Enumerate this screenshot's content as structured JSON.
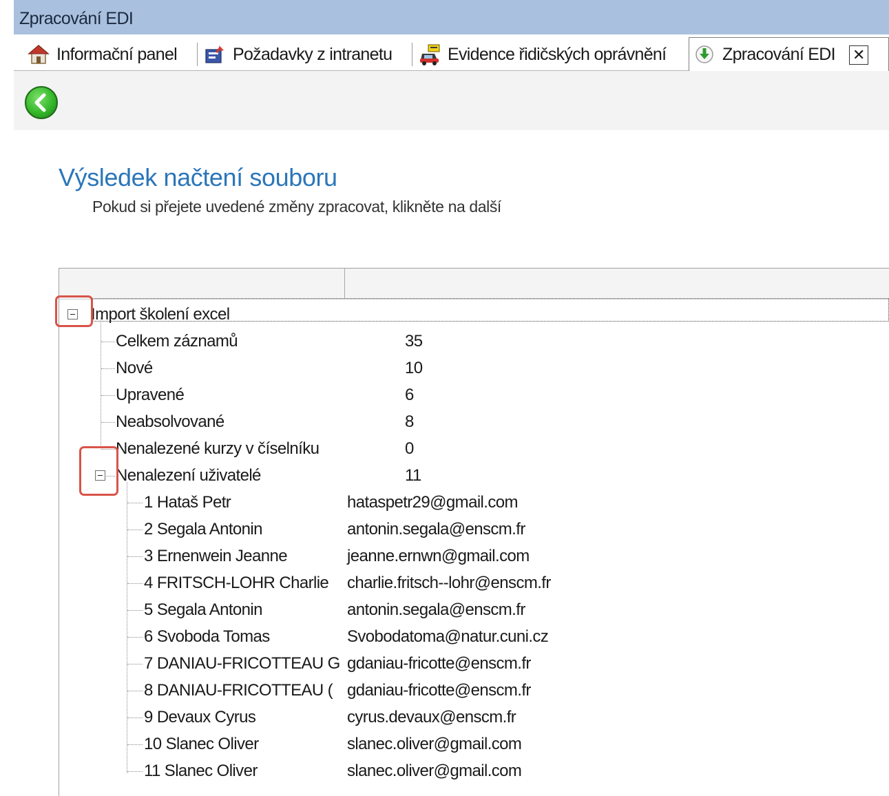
{
  "window": {
    "title": "Zpracování EDI"
  },
  "tabs": [
    {
      "label": "Informační panel",
      "icon": "house-icon",
      "active": false
    },
    {
      "label": "Požadavky z intranetu",
      "icon": "request-icon",
      "active": false
    },
    {
      "label": "Evidence řidičských oprávnění",
      "icon": "car-icon",
      "active": false
    },
    {
      "label": "Zpracování EDI",
      "icon": "download-icon",
      "active": true,
      "close": "✕"
    }
  ],
  "toolbar": {
    "back_icon": "back-arrow-icon"
  },
  "page": {
    "title": "Výsledek načtení souboru",
    "subtitle": "Pokud si přejete uvedené změny zpracovat, klikněte na další"
  },
  "tree": {
    "root": {
      "label": "Import školení excel",
      "expanded": true
    },
    "summary": [
      {
        "label": "Celkem záznamů",
        "value": "35"
      },
      {
        "label": "Nové",
        "value": "10"
      },
      {
        "label": "Upravené",
        "value": "6"
      },
      {
        "label": "Neabsolvované",
        "value": "8"
      },
      {
        "label": "Nenalezené kurzy v číselníku",
        "value": "0"
      }
    ],
    "users_group": {
      "label": "Nenalezení uživatelé",
      "value": "11",
      "expanded": true
    },
    "users": [
      {
        "label": "1 Hataš Petr",
        "value": "hataspetr29@gmail.com"
      },
      {
        "label": "2 Segala Antonin",
        "value": "antonin.segala@enscm.fr"
      },
      {
        "label": "3 Ernenwein Jeanne",
        "value": "jeanne.ernwn@gmail.com"
      },
      {
        "label": "4 FRITSCH-LOHR Charlie",
        "value": "charlie.fritsch--lohr@enscm.fr"
      },
      {
        "label": "5 Segala Antonin",
        "value": "antonin.segala@enscm.fr"
      },
      {
        "label": "6 Svoboda Tomas",
        "value": "Svobodatoma@natur.cuni.cz"
      },
      {
        "label": "7 DANIAU-FRICOTTEAU G",
        "value": "gdaniau-fricotte@enscm.fr"
      },
      {
        "label": "8 DANIAU-FRICOTTEAU (",
        "value": "gdaniau-fricotte@enscm.fr"
      },
      {
        "label": "9 Devaux Cyrus",
        "value": "cyrus.devaux@enscm.fr"
      },
      {
        "label": "10 Slanec Oliver",
        "value": "slanec.oliver@gmail.com"
      },
      {
        "label": "11 Slanec Oliver",
        "value": "slanec.oliver@gmail.com"
      }
    ]
  },
  "colors": {
    "title_bar": "#a9c0de",
    "title_text": "#2b76b9",
    "callout": "#d9534a"
  }
}
